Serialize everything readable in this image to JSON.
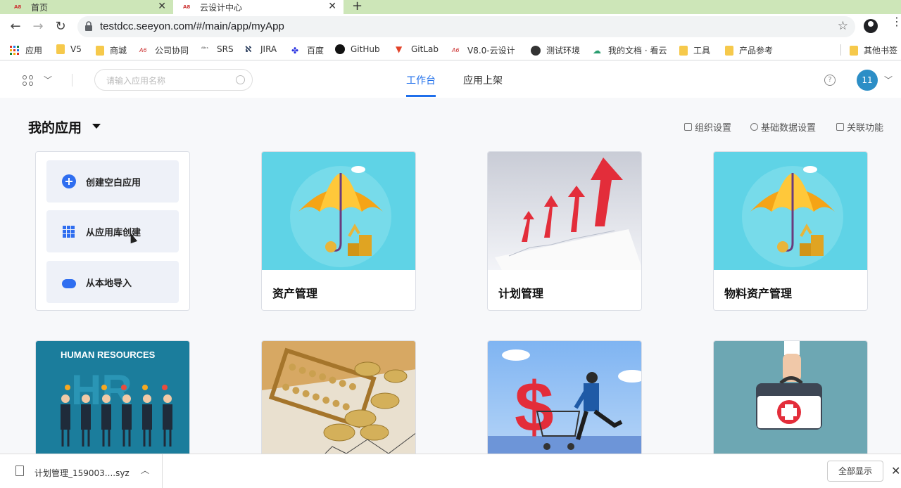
{
  "browser": {
    "tabs": [
      {
        "label": "首页",
        "favicon": "seeyon-logo"
      },
      {
        "label": "云设计中心",
        "favicon": "seeyon-logo"
      }
    ],
    "url": "testdcc.seeyon.com/#/main/app/myApp",
    "bookmarks": [
      {
        "label": "应用",
        "icon": "apps-grid-icon"
      },
      {
        "label": "V5",
        "icon": "folder-icon"
      },
      {
        "label": "商城",
        "icon": "folder-icon"
      },
      {
        "label": "公司协同",
        "icon": "a8-icon"
      },
      {
        "label": "SRS",
        "icon": "a8-icon"
      },
      {
        "label": "JIRA",
        "icon": "jira-icon"
      },
      {
        "label": "百度",
        "icon": "baidu-icon"
      },
      {
        "label": "GitHub",
        "icon": "github-icon"
      },
      {
        "label": "GitLab",
        "icon": "gitlab-icon"
      },
      {
        "label": "V8.0-云设计",
        "icon": "a8-icon"
      },
      {
        "label": "测试环境",
        "icon": "globe-icon"
      },
      {
        "label": "我的文档 · 看云",
        "icon": "kancloud-icon"
      },
      {
        "label": "工具",
        "icon": "folder-icon"
      },
      {
        "label": "产品参考",
        "icon": "folder-icon"
      },
      {
        "label": "其他书签",
        "icon": "folder-icon"
      }
    ]
  },
  "header": {
    "search_placeholder": "请输入应用名称",
    "tabs": [
      {
        "label": "工作台",
        "active": true
      },
      {
        "label": "应用上架",
        "active": false
      }
    ],
    "avatar_text": "11",
    "accent_color": "#1f6feb"
  },
  "main": {
    "title": "我的应用",
    "links": [
      {
        "label": "组织设置",
        "icon": "org-icon"
      },
      {
        "label": "基础数据设置",
        "icon": "database-icon"
      },
      {
        "label": "关联功能",
        "icon": "link-icon"
      }
    ],
    "create": [
      {
        "label": "创建空白应用",
        "icon": "plus-circle-icon"
      },
      {
        "label": "从应用库创建",
        "icon": "apps-grid-icon"
      },
      {
        "label": "从本地导入",
        "icon": "cloud-upload-icon"
      }
    ],
    "apps": [
      {
        "name": "资产管理",
        "image": "umbrella-coins-image"
      },
      {
        "name": "计划管理",
        "image": "red-arrows-chart-image"
      },
      {
        "name": "物料资产管理",
        "image": "umbrella-coins-image"
      }
    ],
    "apps_row2": [
      {
        "name": "",
        "image": "human-resources-image",
        "caption": "HUMAN RESOURCES"
      },
      {
        "name": "",
        "image": "abacus-coins-image"
      },
      {
        "name": "",
        "image": "dollar-cart-image"
      },
      {
        "name": "",
        "image": "first-aid-kit-image"
      }
    ]
  },
  "download": {
    "filename": "计划管理_159003....syz",
    "show_all": "全部显示"
  }
}
